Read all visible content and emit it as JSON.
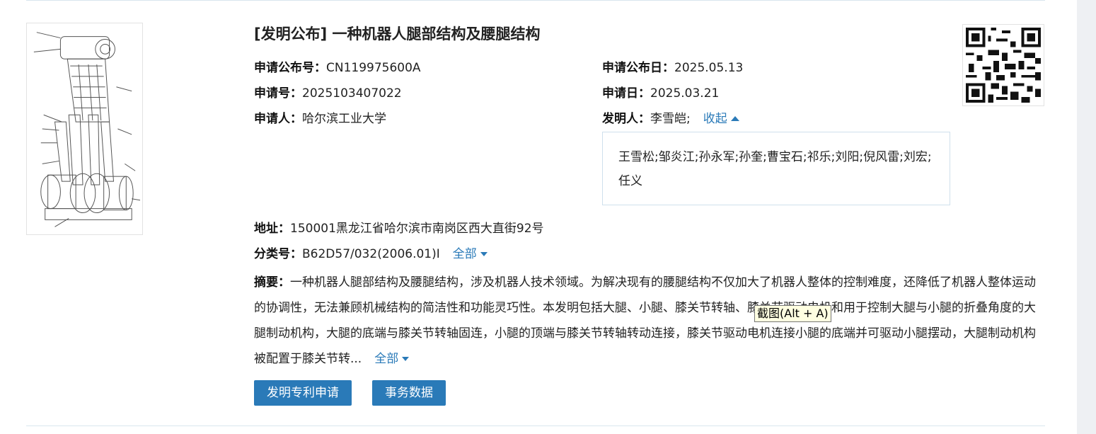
{
  "record": {
    "title": "[发明公布] 一种机器人腿部结构及腰腿结构",
    "pub_no_label": "申请公布号：",
    "pub_no": "CN119975600A",
    "pub_date_label": "申请公布日：",
    "pub_date": "2025.05.13",
    "app_no_label": "申请号：",
    "app_no": "2025103407022",
    "app_date_label": "申请日：",
    "app_date": "2025.03.21",
    "applicant_label": "申请人：",
    "applicant": "哈尔滨工业大学",
    "inventor_label": "发明人：",
    "inventor_first": "李雪皑;",
    "inventor_toggle": "收起",
    "inventors_more": "王雪松;邹炎江;孙永军;孙奎;曹宝石;祁乐;刘阳;倪风雷;刘宏;任义",
    "address_label": "地址：",
    "address": "150001黑龙江省哈尔滨市南岗区西大直街92号",
    "class_label": "分类号：",
    "class_no": "B62D57/032(2006.01)I",
    "class_toggle": "全部",
    "abstract_label": "摘要：",
    "abstract_text": "一种机器人腿部结构及腰腿结构，涉及机器人技术领域。为解决现有的腰腿结构不仅加大了机器人整体的控制难度，还降低了机器人整体运动的协调性，无法兼顾机械结构的简洁性和功能灵巧性。本发明包括大腿、小腿、膝关节转轴、膝关节驱动电机和用于控制大腿与小腿的折叠角度的大腿制动机构，大腿的底端与膝关节转轴固连，小腿的顶端与膝关节转轴转动连接，膝关节驱动电机连接小腿的底端并可驱动小腿摆动，大腿制动机构被配置于膝关节转...",
    "abstract_toggle": "全部"
  },
  "tooltip": "截图(Alt + A)",
  "buttons": {
    "patent_apply": "发明专利申请",
    "affairs": "事务数据"
  },
  "colors": {
    "accent": "#2a7ab8",
    "rule": "#d9e6ee",
    "box_border": "#cfe0ec"
  }
}
